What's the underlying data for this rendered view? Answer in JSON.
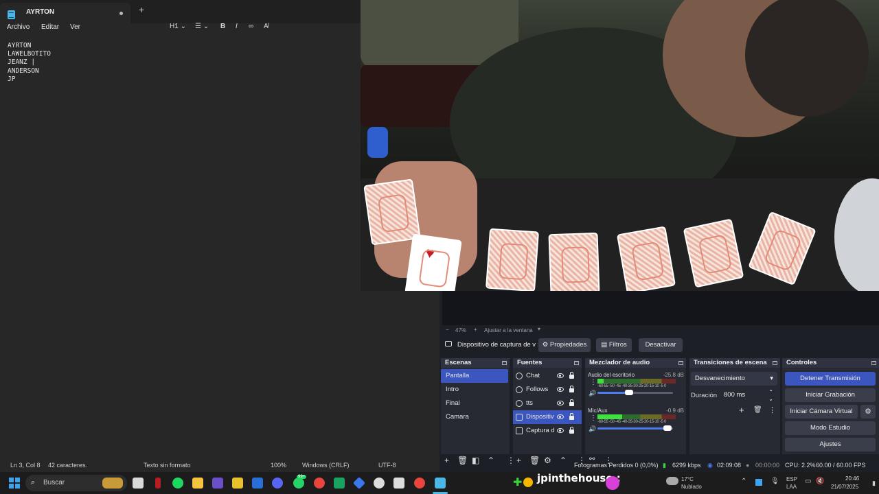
{
  "notepad": {
    "tab_title": "AYRTON",
    "menu": [
      "Archivo",
      "Editar",
      "Ver"
    ],
    "heading_tool": "H1",
    "lines": [
      "AYRTON",
      "LAWELBOTITO",
      "JEANZ |",
      "ANDERSON",
      "JP"
    ],
    "status": {
      "position": "Ln 3, Col 8",
      "chars": "42 caracteres.",
      "format": "Texto sin formato",
      "zoom": "100%",
      "line_ending": "Windows (CRLF)",
      "encoding": "UTF-8"
    }
  },
  "obs": {
    "zoom": "47%",
    "fit": "Ajustar a la ventana",
    "source_name": "Dispositivo de captura de v",
    "properties": "Propiedades",
    "filters": "Filtros",
    "deactivate": "Desactivar",
    "docks": {
      "scenes": "Escenas",
      "sources": "Fuentes",
      "mixer": "Mezclador de audio",
      "transitions": "Transiciones de escena",
      "controls": "Controles"
    },
    "scenes": [
      "Pantalla",
      "Intro",
      "Final",
      "Camara"
    ],
    "sources": [
      "Chat",
      "Follows",
      "tts",
      "Dispositiv",
      "Captura d"
    ],
    "mixer": [
      {
        "name": "Audio del escritorio",
        "db": "-25.8 dB",
        "level": 0.08,
        "volume": 0.42
      },
      {
        "name": "Mic/Aux",
        "db": "-0.9 dB",
        "level": 0.32,
        "volume": 0.93
      }
    ],
    "ticks": "-60-55 -50 -45 -40-35-30-25-20-15-10 -5 0",
    "transition": "Desvanecimiento",
    "duration_label": "Duración",
    "duration": "800 ms",
    "controls": [
      "Detener Transmisión",
      "Iniciar Grabación",
      "Iniciar Cámara Virtual",
      "Modo Estudio",
      "Ajustes"
    ],
    "status": {
      "dropped": "Fotogramas Perdidos 0 (0,0%)",
      "bitrate": "6299 kbps",
      "stream_time": "02:09:08",
      "rec_time": "00:00:00",
      "cpu": "CPU: 2.2%",
      "fps": "60.00 / 60.00 FPS"
    }
  },
  "taskbar": {
    "search": "Buscar",
    "badge": "99+",
    "overlay": "jpinthehouse :",
    "weather_temp": "17°C",
    "weather_desc": "Nublado",
    "lang": "ESP",
    "lang2": "LAA",
    "time": "20:46",
    "date": "21/07/2025"
  },
  "colors": {
    "accent": "#3c56bf",
    "notepad_bg": "#272727",
    "obs_bg": "#1d1f26"
  }
}
